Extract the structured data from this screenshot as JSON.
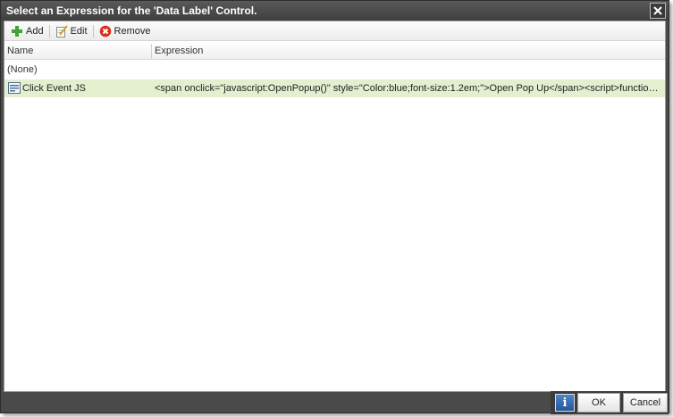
{
  "dialog": {
    "title": "Select an Expression for the 'Data Label' Control."
  },
  "toolbar": {
    "add_label": "Add",
    "edit_label": "Edit",
    "remove_label": "Remove"
  },
  "table": {
    "columns": [
      "Name",
      "Expression"
    ],
    "rows": [
      {
        "name": "(None)",
        "expression": ""
      },
      {
        "name": "Click Event JS",
        "expression": "<span onclick=\"javascript:OpenPopup()\" style=\"Color:blue;font-size:1.2em;\">Open Pop Up</span><script>function Ope...",
        "selected": true
      }
    ]
  },
  "footer": {
    "info_label": "i",
    "ok_label": "OK",
    "cancel_label": "Cancel"
  },
  "colors": {
    "titlebar": "#4a4a4a",
    "selected_row": "#e3efcf",
    "add_icon": "#3fa33a",
    "remove_icon": "#d9301c",
    "info_button": "#2f68b0"
  },
  "icons": {
    "close": "close-icon",
    "add": "add-icon",
    "edit": "edit-icon",
    "remove": "remove-icon",
    "expression": "expression-icon",
    "info": "info-icon"
  }
}
